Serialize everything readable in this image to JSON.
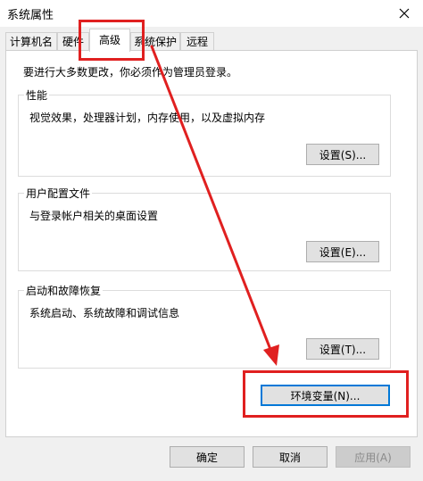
{
  "window": {
    "title": "系统属性"
  },
  "tabs": [
    {
      "label": "计算机名"
    },
    {
      "label": "硬件"
    },
    {
      "label": "高级"
    },
    {
      "label": "系统保护"
    },
    {
      "label": "远程"
    }
  ],
  "notice": "要进行大多数更改，你必须作为管理员登录。",
  "groups": {
    "performance": {
      "label": "性能",
      "desc": "视觉效果，处理器计划，内存使用，以及虚拟内存",
      "button": "设置(S)..."
    },
    "profiles": {
      "label": "用户配置文件",
      "desc": "与登录帐户相关的桌面设置",
      "button": "设置(E)..."
    },
    "startup": {
      "label": "启动和故障恢复",
      "desc": "系统启动、系统故障和调试信息",
      "button": "设置(T)..."
    }
  },
  "env_button": "环境变量(N)...",
  "footer": {
    "ok": "确定",
    "cancel": "取消",
    "apply": "应用(A)"
  },
  "colors": {
    "annotation": "#e02020",
    "focus": "#0078d7"
  },
  "icons": {
    "close": "close-icon"
  }
}
